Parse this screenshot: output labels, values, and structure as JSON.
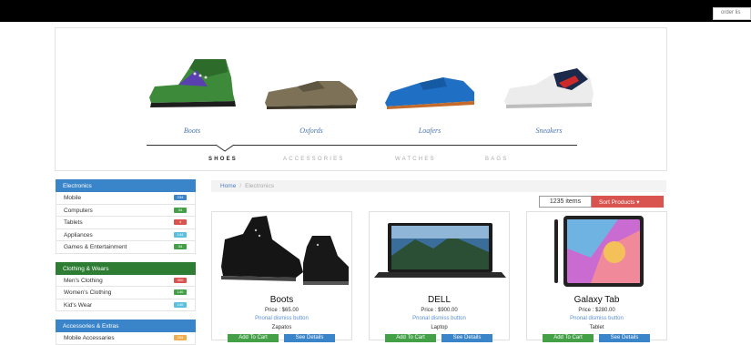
{
  "topbar": {
    "input_placeholder": "order lis"
  },
  "categories": [
    {
      "label": "Boots"
    },
    {
      "label": "Oxfords"
    },
    {
      "label": "Loafers"
    },
    {
      "label": "Sneakers"
    }
  ],
  "tabs": [
    {
      "label": "SHOES",
      "active": true
    },
    {
      "label": "ACCESSORIES"
    },
    {
      "label": "WATCHES"
    },
    {
      "label": "BAGS"
    }
  ],
  "sidebar": {
    "groups": [
      {
        "title": "Electronics",
        "color": "#3a84c9",
        "items": [
          {
            "label": "Mobile",
            "count": "234",
            "badge_color": "#3a84c9"
          },
          {
            "label": "Computers",
            "count": "34",
            "badge_color": "#43a047"
          },
          {
            "label": "Tablets",
            "count": "4",
            "badge_color": "#d9534f"
          },
          {
            "label": "Appliances",
            "count": "144",
            "badge_color": "#5bc0de"
          },
          {
            "label": "Games & Entertainment",
            "count": "34",
            "badge_color": "#43a047"
          }
        ]
      },
      {
        "title": "Clothing & Wears",
        "color": "#2f7d34",
        "items": [
          {
            "label": "Men's Clothing",
            "count": "300",
            "badge_color": "#d9534f"
          },
          {
            "label": "Women's Clothing",
            "count": "140",
            "badge_color": "#43a047"
          },
          {
            "label": "Kid's Wear",
            "count": "140",
            "badge_color": "#5bc0de"
          }
        ]
      },
      {
        "title": "Accessories & Extras",
        "color": "#3a84c9",
        "items": [
          {
            "label": "Mobile Accessaries",
            "count": "204",
            "badge_color": "#f0ad4e"
          }
        ]
      }
    ]
  },
  "breadcrumb": {
    "home": "Home",
    "separator": "/",
    "current": "Electronics"
  },
  "toolbar": {
    "items_count": "1235 items",
    "sort_label": "Sort Products",
    "sort_caret": "▾"
  },
  "products": [
    {
      "title": "Boots",
      "price": "Price : $65.00",
      "dismiss": "Pnonal dismiss button",
      "category": "Zapatos",
      "add_label": "Add To Cart",
      "details_label": "See Details"
    },
    {
      "title": "DELL",
      "price": "Price : $900.00",
      "dismiss": "Pnonal dismiss button",
      "category": "Laptop",
      "add_label": "Add To Cart",
      "details_label": "See Details"
    },
    {
      "title": "Galaxy Tab",
      "price": "Price : $280.00",
      "dismiss": "Pnonal dismiss button",
      "category": "Tablet",
      "add_label": "Add To Cart",
      "details_label": "See Details"
    }
  ]
}
